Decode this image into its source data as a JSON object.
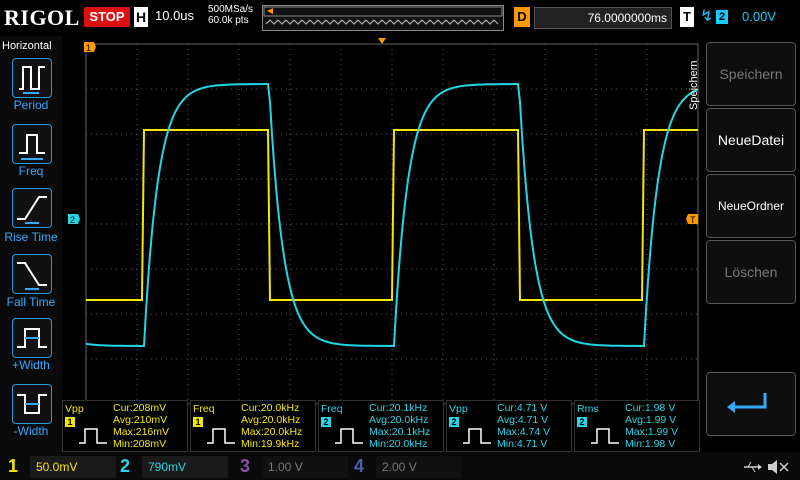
{
  "brand": "RIGOL",
  "run_state": "STOP",
  "horizontal": {
    "label": "H",
    "timebase": "10.0us",
    "sample_rate": "500MSa/s",
    "points": "60.0k pts"
  },
  "delay": {
    "label": "D",
    "value": "76.0000000ms"
  },
  "trigger": {
    "label": "T",
    "edge_icon": "rising-edge-icon",
    "channel": "2",
    "level": "0.00V"
  },
  "left_menu": {
    "title": "Horizontal",
    "items": [
      {
        "label": "Period",
        "icon": "period-icon"
      },
      {
        "label": "Freq",
        "icon": "freq-icon"
      },
      {
        "label": "Rise Time",
        "icon": "rise-time-icon"
      },
      {
        "label": "Fall Time",
        "icon": "fall-time-icon"
      },
      {
        "label": "+Width",
        "icon": "pos-width-icon"
      },
      {
        "label": "-Width",
        "icon": "neg-width-icon"
      }
    ]
  },
  "right_menu": {
    "title": "Speichern",
    "items": [
      {
        "label": "Speichern",
        "enabled": false
      },
      {
        "label": "NeueDatei",
        "enabled": true
      },
      {
        "label": "NeueOrdner",
        "enabled": true
      },
      {
        "label": "Löschen",
        "enabled": false
      },
      {
        "label": "",
        "icon": "enter-return-icon",
        "enabled": true
      }
    ]
  },
  "measurements": [
    {
      "name": "Vpp",
      "channel": "1",
      "cur": "Cur:208mV",
      "avg": "Avg:210mV",
      "max": "Max:216mV",
      "min": "Min:208mV",
      "color": "#f4e800"
    },
    {
      "name": "Freq",
      "channel": "1",
      "cur": "Cur:20.0kHz",
      "avg": "Avg:20.0kHz",
      "max": "Max:20.0kHz",
      "min": "Min:19.9kHz",
      "color": "#f4e800"
    },
    {
      "name": "Freq",
      "channel": "2",
      "cur": "Cur:20.1kHz",
      "avg": "Avg:20.0kHz",
      "max": "Max:20.1kHz",
      "min": "Min:20.0kHz",
      "color": "#22d6e6"
    },
    {
      "name": "Vpp",
      "channel": "2",
      "cur": "Cur:4.71 V",
      "avg": "Avg:4.71 V",
      "max": "Max:4.74 V",
      "min": "Min:4.71 V",
      "color": "#22d6e6"
    },
    {
      "name": "Rms",
      "channel": "2",
      "cur": "Cur:1.98 V",
      "avg": "Avg:1.99 V",
      "max": "Max:1.99 V",
      "min": "Min:1.98 V",
      "color": "#22d6e6"
    }
  ],
  "channels": [
    {
      "num": "1",
      "scale": "50.0mV",
      "coupling_icon": "~",
      "active": true,
      "color": "#f4e800"
    },
    {
      "num": "2",
      "scale": "790mV",
      "coupling_icon": "~",
      "active": true,
      "color": "#22d6e6"
    },
    {
      "num": "3",
      "scale": "1.00 V",
      "active": false,
      "color": "#8a4fa8"
    },
    {
      "num": "4",
      "scale": "2.00 V",
      "active": false,
      "color": "#4a5fb0"
    }
  ],
  "markers": {
    "ch1": "1",
    "ch2": "2",
    "trigger": "T"
  },
  "colors": {
    "ch1": "#f4e800",
    "ch2": "#22d6e6",
    "accent": "#2a9cd7",
    "stop": "#d11111"
  }
}
